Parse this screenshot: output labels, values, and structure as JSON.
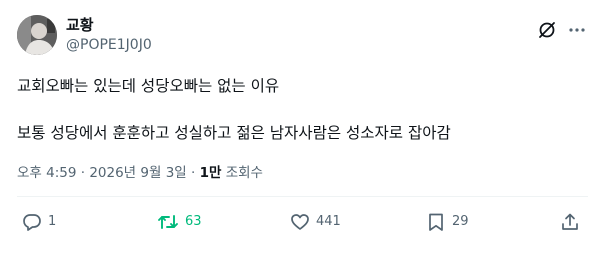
{
  "author": {
    "display_name": "교황",
    "handle": "@POPE1J0J0"
  },
  "tweet": {
    "line1": "교회오빠는 있는데 성당오빠는 없는 이유",
    "line2": "보통 성당에서 훈훈하고 성실하고 젊은 남자사람은 성소자로 잡아감"
  },
  "meta": {
    "timestamp": "오후 4:59 · 2026년 9월 3일 · ",
    "views_count": "1만",
    "views_label": " 조회수"
  },
  "actions": {
    "reply_count": "1",
    "retweet_count": "63",
    "like_count": "441",
    "bookmark_count": "29"
  },
  "colors": {
    "text": "#0f1419",
    "secondary": "#536471",
    "retweet_active": "#00ba7c",
    "divider": "#eff3f4"
  },
  "icons": [
    "grok-icon",
    "more-icon",
    "reply-icon",
    "retweet-icon",
    "like-icon",
    "bookmark-icon",
    "share-icon"
  ]
}
